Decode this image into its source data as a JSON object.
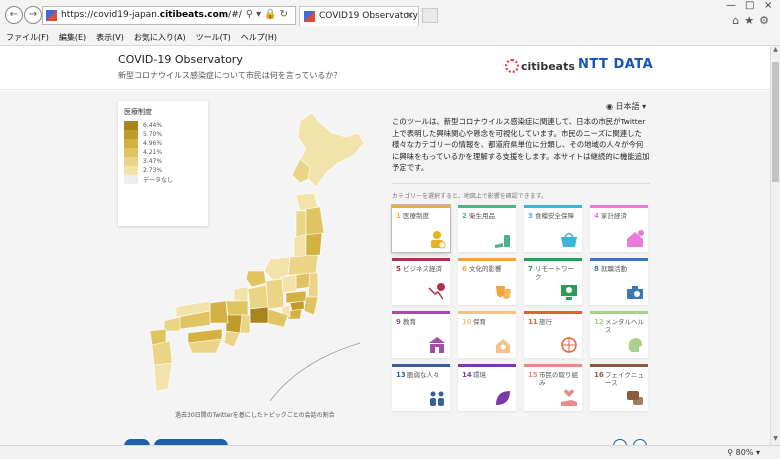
{
  "browser": {
    "url_prefix": "https://covid19-japan.",
    "url_host": "citibeats.com",
    "url_suffix": "/#/",
    "tab_title": "COVID19 Observatory",
    "menu": [
      "ファイル(F)",
      "編集(E)",
      "表示(V)",
      "お気に入り(A)",
      "ツール(T)",
      "ヘルプ(H)"
    ],
    "zoom": "80%"
  },
  "header": {
    "title": "COVID-19 Observatory",
    "subtitle": "新型コロナウイルス感染症について市民は何を言っているか？",
    "logo_citibeats": "citibeats",
    "logo_ntt": "NTT DATA"
  },
  "legend": {
    "title": "医療制度",
    "items": [
      {
        "label": "6.44%",
        "color": "#a8841e"
      },
      {
        "label": "5.70%",
        "color": "#c09a2c"
      },
      {
        "label": "4.96%",
        "color": "#d3b142"
      },
      {
        "label": "4.21%",
        "color": "#e0c461"
      },
      {
        "label": "3.47%",
        "color": "#ead486"
      },
      {
        "label": "2.73%",
        "color": "#f2e3ab"
      },
      {
        "label": "データなし",
        "color": "#eeeeee"
      }
    ]
  },
  "map": {
    "caption": "過去30日間のTwitterを基にしたトピックごとの会話の割合"
  },
  "language": "日本語",
  "intro": "このツールは、新型コロナウイルス感染症に関連して、日本の市民がTwitter上で表明した興味関心や懸念を可視化しています。市民のニーズに関連した様々なカテゴリーの情報を、都道府県単位に分類し、その地域の人々が今何に興味をもっているかを理解する支援をします。本サイトは継続的に機能追加予定です。",
  "hint": "カテゴリーを選択すると、地図上で影響を確認できます。",
  "categories": [
    {
      "num": "1",
      "name": "医療制度",
      "color": "#e8b321",
      "icon": "doctor-icon"
    },
    {
      "num": "2",
      "name": "衛生用品",
      "color": "#4fb38a",
      "icon": "hand-sanitizer-icon"
    },
    {
      "num": "3",
      "name": "食糧安全保障",
      "color": "#3bb6d8",
      "icon": "basket-icon"
    },
    {
      "num": "4",
      "name": "家計経済",
      "color": "#e87ad8",
      "icon": "house-icon"
    },
    {
      "num": "5",
      "name": "ビジネス経済",
      "color": "#b0304a",
      "icon": "yen-chart-icon"
    },
    {
      "num": "6",
      "name": "文化的影響",
      "color": "#f2a33a",
      "icon": "theater-mask-icon"
    },
    {
      "num": "7",
      "name": "リモートワーク",
      "color": "#2e9a5a",
      "icon": "remote-work-icon"
    },
    {
      "num": "8",
      "name": "就職活動",
      "color": "#3a78b5",
      "icon": "job-search-icon"
    },
    {
      "num": "9",
      "name": "教育",
      "color": "#a94ca8",
      "icon": "school-icon"
    },
    {
      "num": "10",
      "name": "保育",
      "color": "#f2c48a",
      "icon": "childcare-icon"
    },
    {
      "num": "11",
      "name": "旅行",
      "color": "#e0623a",
      "icon": "globe-plane-icon"
    },
    {
      "num": "12",
      "name": "メンタルヘルス",
      "color": "#a9d18e",
      "icon": "mental-health-icon"
    },
    {
      "num": "13",
      "name": "脆弱な人々",
      "color": "#3a5fa0",
      "icon": "people-icon"
    },
    {
      "num": "14",
      "name": "環境",
      "color": "#7a3aa8",
      "icon": "leaf-icon"
    },
    {
      "num": "15",
      "name": "市民の取り組み",
      "color": "#e88a8a",
      "icon": "hand-heart-icon"
    },
    {
      "num": "16",
      "name": "フェイクニュース",
      "color": "#8a5a3a",
      "icon": "speech-icon"
    }
  ],
  "colors": {
    "accent": "#1e5fa8",
    "selected_card_border": "#e8b321"
  }
}
